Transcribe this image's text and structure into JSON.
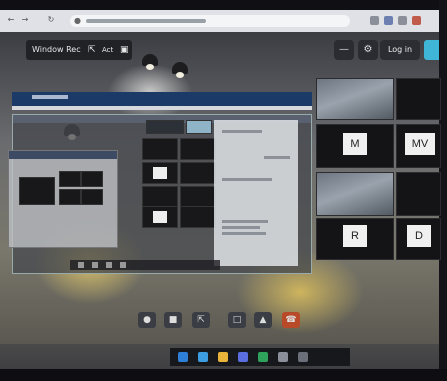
{
  "toolbar": {
    "left_label": "Window Rec",
    "left_label_2": "Act",
    "login_label": "Log in"
  },
  "tiles": {
    "m_initial": "M",
    "mv_initial": "MV",
    "r_initial": "R",
    "d_initial": "D"
  },
  "colors": {
    "accent": "#3fb6d8",
    "caption_bar": "#1c3a68",
    "leave_button": "#b84a2a"
  },
  "icons": {
    "back": "arrow-left-icon",
    "forward": "arrow-right-icon",
    "reload": "reload-icon",
    "lock": "lock-icon",
    "share": "share-screen-icon",
    "minus": "minus-icon",
    "settings": "gear-icon",
    "mic": "microphone-icon",
    "camera": "camera-icon",
    "chat": "chat-icon",
    "leave": "phone-hangup-icon"
  }
}
